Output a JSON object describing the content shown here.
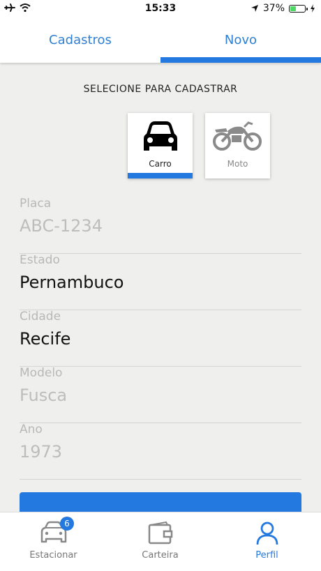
{
  "status_bar": {
    "time": "15:33",
    "battery": "37%"
  },
  "tabs": [
    {
      "label": "Cadastros",
      "active": false
    },
    {
      "label": "Novo",
      "active": true
    }
  ],
  "select_title": "SELECIONE PARA CADASTRAR",
  "vehicle_types": [
    {
      "label": "Carro",
      "icon": "car-icon",
      "selected": true
    },
    {
      "label": "Moto",
      "icon": "motorcycle-icon",
      "selected": false
    }
  ],
  "form": {
    "placa": {
      "label": "Placa",
      "placeholder": "ABC-1234"
    },
    "estado": {
      "label": "Estado",
      "value": "Pernambuco"
    },
    "cidade": {
      "label": "Cidade",
      "value": "Recife"
    },
    "modelo": {
      "label": "Modelo",
      "placeholder": "Fusca"
    },
    "ano": {
      "label": "Ano",
      "placeholder": "1973"
    }
  },
  "bottom_nav": [
    {
      "label": "Estacionar",
      "icon": "car-outline-icon",
      "badge": "6",
      "active": false
    },
    {
      "label": "Carteira",
      "icon": "wallet-icon",
      "active": false
    },
    {
      "label": "Perfil",
      "icon": "user-icon",
      "active": true
    }
  ],
  "colors": {
    "accent": "#2479e0",
    "tab_text": "#2f7fd3",
    "background": "#efefed"
  }
}
